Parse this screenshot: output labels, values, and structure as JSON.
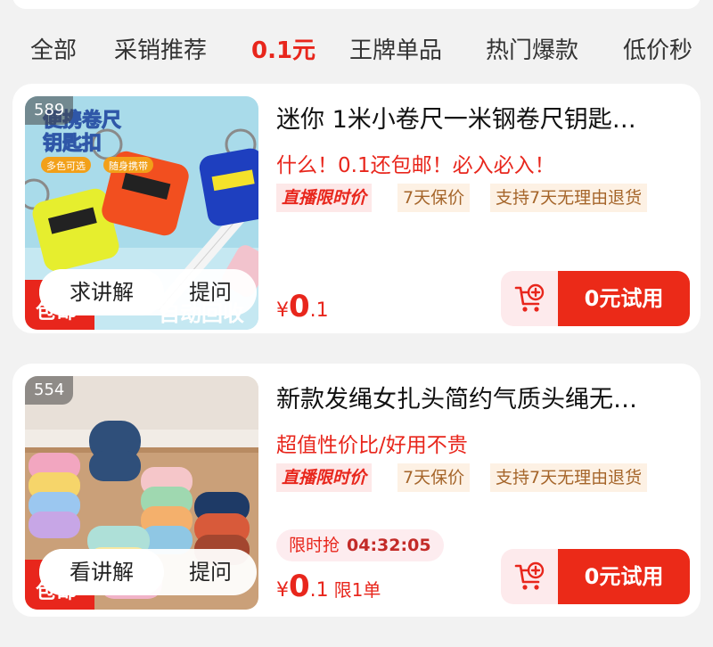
{
  "tabs": [
    "全部",
    "采销推荐",
    "0.1元",
    "王牌单品",
    "热门爆款",
    "低价秒"
  ],
  "active_tab_index": 2,
  "products": [
    {
      "rank": "589",
      "title": "迷你 1米小卷尺一米钢卷尺钥匙…",
      "slogan": "什么！0.1还包邮！必入必入！",
      "tags": [
        "直播限时价",
        "7天保价",
        "支持7天无理由退货"
      ],
      "price_symbol": "¥",
      "price_big": "0",
      "price_small": ".1",
      "price_note": "",
      "flash_label": "",
      "flash_time": "",
      "ask_label": "求讲解",
      "question_label": "提问",
      "try_label": "0元试用",
      "image_texts": [
        "便携卷尺",
        "钥匙扣",
        "多色可选",
        "随身携带",
        "包邮",
        "自动回收"
      ]
    },
    {
      "rank": "554",
      "title": "新款发绳女扎头简约气质头绳无…",
      "slogan": "超值性价比/好用不贵",
      "tags": [
        "直播限时价",
        "7天保价",
        "支持7天无理由退货"
      ],
      "price_symbol": "¥",
      "price_big": "0",
      "price_small": ".1",
      "price_note": "限1单",
      "flash_label": "限时抢",
      "flash_time": "04:32:05",
      "ask_label": "看讲解",
      "question_label": "提问",
      "try_label": "0元试用",
      "image_texts": [
        "包邮"
      ]
    }
  ],
  "colors": {
    "accent": "#e8261c",
    "try_button": "#eb2a18",
    "tag_bg": "#fdf1e4",
    "tag_text": "#a5652a"
  },
  "icons": [
    "cart-add-icon"
  ]
}
